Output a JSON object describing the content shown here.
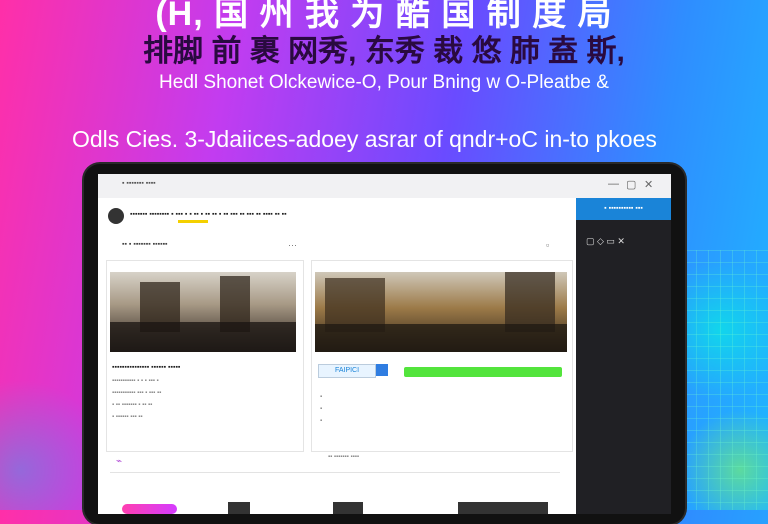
{
  "headline": {
    "top": "(H, 国 州 我 为 酷 国 制 度 局",
    "cn": "排脚 前 裹 网秀, 东秀 裁 悠 肺 盍 斯,",
    "subtitle": "Hedl Shonet Olckewice-O, Pour Bning w O-Pleatbe &",
    "tagline": "Odls Cies. 3-Jdaiices-adoey asrar of qndr+oC in-to pkoes"
  },
  "browser": {
    "topbar_text": "▪  ▪▪▪▪▪▪▪ ▪▪▪▪",
    "controls": [
      "—",
      "▢",
      "✕"
    ]
  },
  "sidebar": {
    "button_label": "▪ ▪▪▪▪▪▪▪▪▪▪ ▪▪▪",
    "icons_text": "▢ ◇ ▭ ✕"
  },
  "page": {
    "header_text": "▪▪▪▪▪▪▪ ▪▪▪▪▪▪▪▪ ▪ ▪▪▪ ▪ ▪ ▪▪ ▪ ▪▪ ▪▪ ▪ ▪▪ ▪▪▪ ▪▪ ▪▪▪ ▪▪ ▪▪▪▪ ▪▪ ▪▪",
    "breadcrumb": "▪▪ ▪ ▪▪▪▪▪▪▪ ▪▪▪▪▪▪",
    "card1": {
      "title": "▪▪▪▪▪▪▪▪▪▪▪▪▪▪▪ ▪▪▪▪▪▪ ▪▪▪▪▪",
      "lines": [
        "▪▪▪▪▪▪▪▪▪▪▪ ▪ ▪ ▪ ▪▪▪ ▪",
        "▪▪▪▪▪▪▪▪▪▪▪ ▪▪▪ ▪ ▪▪▪ ▪▪",
        "▪ ▪▪ ▪▪▪▪▪▪▪ ▪ ▪▪ ▪▪",
        "▪ ▪▪▪▪▪▪ ▪▪▪ ▪▪"
      ]
    },
    "card2": {
      "tag_label": "FAIPICI",
      "lines": [
        "▪",
        "▪",
        "▪"
      ]
    },
    "footer_sigil": "⌁",
    "footer_text": "▪▪ ▪▪▪▪▪▪▪ ▪▪▪▪"
  },
  "colors": {
    "accent_blue": "#1a84d8",
    "progress_green": "#53e43c",
    "sidebar_bg": "#202024"
  }
}
